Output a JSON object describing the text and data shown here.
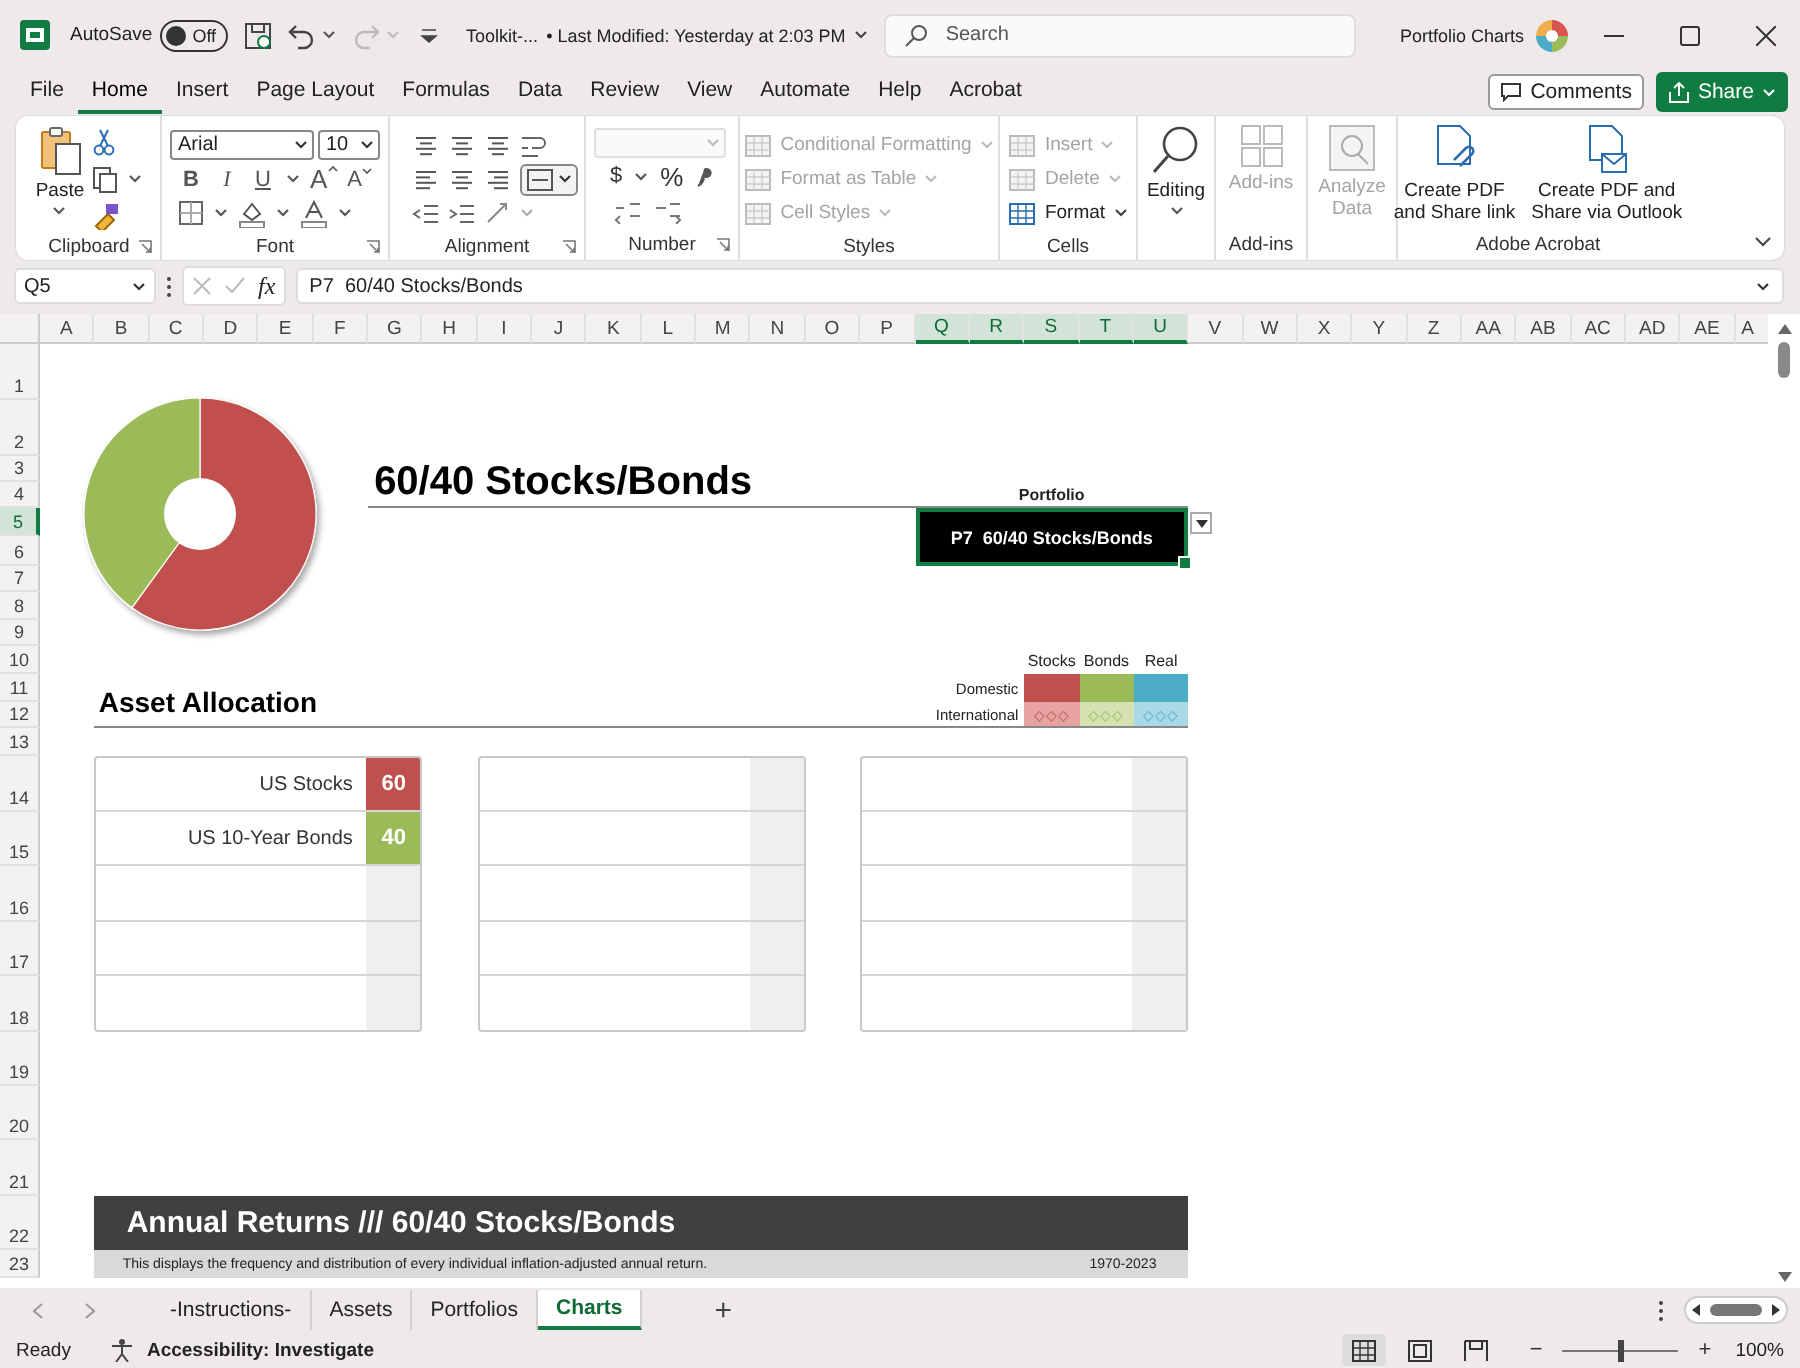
{
  "title_bar": {
    "autosave_label": "AutoSave",
    "autosave": {
      "label": "Off",
      "on": false
    },
    "file_name": "Toolkit-...",
    "last_modified": "• Last Modified: Yesterday at 2:03 PM",
    "search": {
      "placeholder": "Search"
    },
    "account": "Portfolio Charts"
  },
  "menu_tabs": [
    {
      "label": "File",
      "selected": false
    },
    {
      "label": "Home",
      "selected": true
    },
    {
      "label": "Insert",
      "selected": false
    },
    {
      "label": "Page Layout",
      "selected": false
    },
    {
      "label": "Formulas",
      "selected": false
    },
    {
      "label": "Data",
      "selected": false
    },
    {
      "label": "Review",
      "selected": false
    },
    {
      "label": "View",
      "selected": false
    },
    {
      "label": "Automate",
      "selected": false
    },
    {
      "label": "Help",
      "selected": false
    },
    {
      "label": "Acrobat",
      "selected": false
    }
  ],
  "comments_button": "Comments",
  "share_button": "Share",
  "ribbon": {
    "groups": [
      {
        "kind": "clipboard",
        "label": "Clipboard",
        "paste": "Paste"
      },
      {
        "kind": "font",
        "label": "Font",
        "font_name": "Arial",
        "font_size": "10",
        "style_buttons": [
          "B",
          "I",
          "U"
        ],
        "size_buttons": [
          "A",
          "A"
        ]
      },
      {
        "kind": "alignment",
        "label": "Alignment"
      },
      {
        "kind": "number",
        "label": "Number",
        "currency": "$",
        "percent": "%"
      },
      {
        "kind": "styles",
        "label": "Styles",
        "items": [
          {
            "label": "Conditional Formatting",
            "disabled": true
          },
          {
            "label": "Format as Table",
            "disabled": true
          },
          {
            "label": "Cell Styles",
            "disabled": true
          }
        ]
      },
      {
        "kind": "cells",
        "label": "Cells",
        "items": [
          {
            "label": "Insert",
            "disabled": true
          },
          {
            "label": "Delete",
            "disabled": true
          },
          {
            "label": "Format",
            "disabled": false
          }
        ]
      },
      {
        "kind": "editing",
        "button": {
          "label": "Editing",
          "disabled": false
        }
      },
      {
        "kind": "addins",
        "label": "Add-ins",
        "button": {
          "label": "Add-ins",
          "disabled": true
        }
      },
      {
        "kind": "analyze",
        "button": {
          "label": "Analyze\nData",
          "disabled": true
        }
      },
      {
        "kind": "acrobat",
        "label": "Adobe Acrobat",
        "buttons": [
          {
            "label": "Create PDF\nand Share link",
            "disabled": false
          },
          {
            "label": "Create PDF and\nShare via Outlook",
            "disabled": false
          }
        ]
      }
    ]
  },
  "formula_bar": {
    "name_box": "Q5",
    "function_label": "fx",
    "formula": "P7  60/40 Stocks/Bonds"
  },
  "sheet": {
    "columns": [
      {
        "label": "A",
        "selected": false
      },
      {
        "label": "B",
        "selected": false
      },
      {
        "label": "C",
        "selected": false
      },
      {
        "label": "D",
        "selected": false
      },
      {
        "label": "E",
        "selected": false
      },
      {
        "label": "F",
        "selected": false
      },
      {
        "label": "G",
        "selected": false
      },
      {
        "label": "H",
        "selected": false
      },
      {
        "label": "I",
        "selected": false
      },
      {
        "label": "J",
        "selected": false
      },
      {
        "label": "K",
        "selected": false
      },
      {
        "label": "L",
        "selected": false
      },
      {
        "label": "M",
        "selected": false
      },
      {
        "label": "N",
        "selected": false
      },
      {
        "label": "O",
        "selected": false
      },
      {
        "label": "P",
        "selected": false
      },
      {
        "label": "Q",
        "selected": true
      },
      {
        "label": "R",
        "selected": true
      },
      {
        "label": "S",
        "selected": true
      },
      {
        "label": "T",
        "selected": true
      },
      {
        "label": "U",
        "selected": true
      },
      {
        "label": "V",
        "selected": false
      },
      {
        "label": "W",
        "selected": false
      },
      {
        "label": "X",
        "selected": false
      },
      {
        "label": "Y",
        "selected": false
      },
      {
        "label": "Z",
        "selected": false
      },
      {
        "label": "AA",
        "selected": false
      },
      {
        "label": "AB",
        "selected": false
      },
      {
        "label": "AC",
        "selected": false
      },
      {
        "label": "AD",
        "selected": false
      },
      {
        "label": "AE",
        "selected": false
      },
      {
        "label": "A",
        "selected": false
      }
    ],
    "rows": [
      {
        "label": "1",
        "selected": false
      },
      {
        "label": "2",
        "selected": false
      },
      {
        "label": "3",
        "selected": false
      },
      {
        "label": "4",
        "selected": false
      },
      {
        "label": "5",
        "selected": true
      },
      {
        "label": "6",
        "selected": false
      },
      {
        "label": "7",
        "selected": false
      },
      {
        "label": "8",
        "selected": false
      },
      {
        "label": "9",
        "selected": false
      },
      {
        "label": "10",
        "selected": false
      },
      {
        "label": "11",
        "selected": false
      },
      {
        "label": "12",
        "selected": false
      },
      {
        "label": "13",
        "selected": false
      },
      {
        "label": "14",
        "selected": false
      },
      {
        "label": "15",
        "selected": false
      },
      {
        "label": "16",
        "selected": false
      },
      {
        "label": "17",
        "selected": false
      },
      {
        "label": "18",
        "selected": false
      },
      {
        "label": "19",
        "selected": false
      },
      {
        "label": "20",
        "selected": false
      },
      {
        "label": "21",
        "selected": false
      },
      {
        "label": "22",
        "selected": false
      },
      {
        "label": "23",
        "selected": false
      }
    ],
    "title": "60/40 Stocks/Bonds",
    "portfolio_label": "Portfolio",
    "portfolio_select": {
      "value": "P7  60/40 Stocks/Bonds"
    },
    "legend": {
      "columns": [
        "Stocks",
        "Bonds",
        "Real"
      ],
      "rows": [
        {
          "label": "Domestic",
          "kind": "solid",
          "cells": [
            {
              "color": "#c0504d"
            },
            {
              "color": "#9bbb59"
            },
            {
              "color": "#4bacc6"
            }
          ]
        },
        {
          "label": "International",
          "kind": "pattern",
          "cells": [
            {
              "color": "#e6a3a1",
              "marks": "◇◇◇"
            },
            {
              "color": "#d3e2b0",
              "marks": "◇◇◇"
            },
            {
              "color": "#a9d9e7",
              "marks": "◇◇◇"
            }
          ]
        }
      ]
    },
    "asset_allocation": {
      "title": "Asset Allocation",
      "tables": [
        {
          "rows": [
            {
              "kind": "filled",
              "name": "US Stocks",
              "value": "60",
              "color": "#c0504d"
            },
            {
              "kind": "filled",
              "name": "US 10-Year Bonds",
              "value": "40",
              "color": "#9bbb59"
            },
            {
              "kind": "empty"
            },
            {
              "kind": "empty"
            },
            {
              "kind": "empty"
            }
          ]
        },
        {
          "rows": [
            {
              "kind": "empty"
            },
            {
              "kind": "empty"
            },
            {
              "kind": "empty"
            },
            {
              "kind": "empty"
            },
            {
              "kind": "empty"
            }
          ]
        },
        {
          "rows": [
            {
              "kind": "empty"
            },
            {
              "kind": "empty"
            },
            {
              "kind": "empty"
            },
            {
              "kind": "empty"
            },
            {
              "kind": "empty"
            }
          ]
        }
      ]
    },
    "annual_returns": {
      "title": "Annual Returns /// 60/40 Stocks/Bonds",
      "description": "This displays the frequency and distribution of every individual inflation-adjusted annual return.",
      "years": "1970-2023"
    }
  },
  "sheet_tabs": [
    {
      "label": "-Instructions-",
      "selected": false
    },
    {
      "label": "Assets",
      "selected": false
    },
    {
      "label": "Portfolios",
      "selected": false
    },
    {
      "label": "Charts",
      "selected": true
    }
  ],
  "add_sheet": "+",
  "status_bar": {
    "ready": "Ready",
    "accessibility": "Accessibility: Investigate",
    "views": [
      {
        "selected": true
      },
      {
        "selected": false
      },
      {
        "selected": false
      }
    ],
    "zoom_out": "−",
    "zoom_in": "+",
    "zoom": {
      "level": 0.5
    },
    "zoom_label": "100%"
  }
}
